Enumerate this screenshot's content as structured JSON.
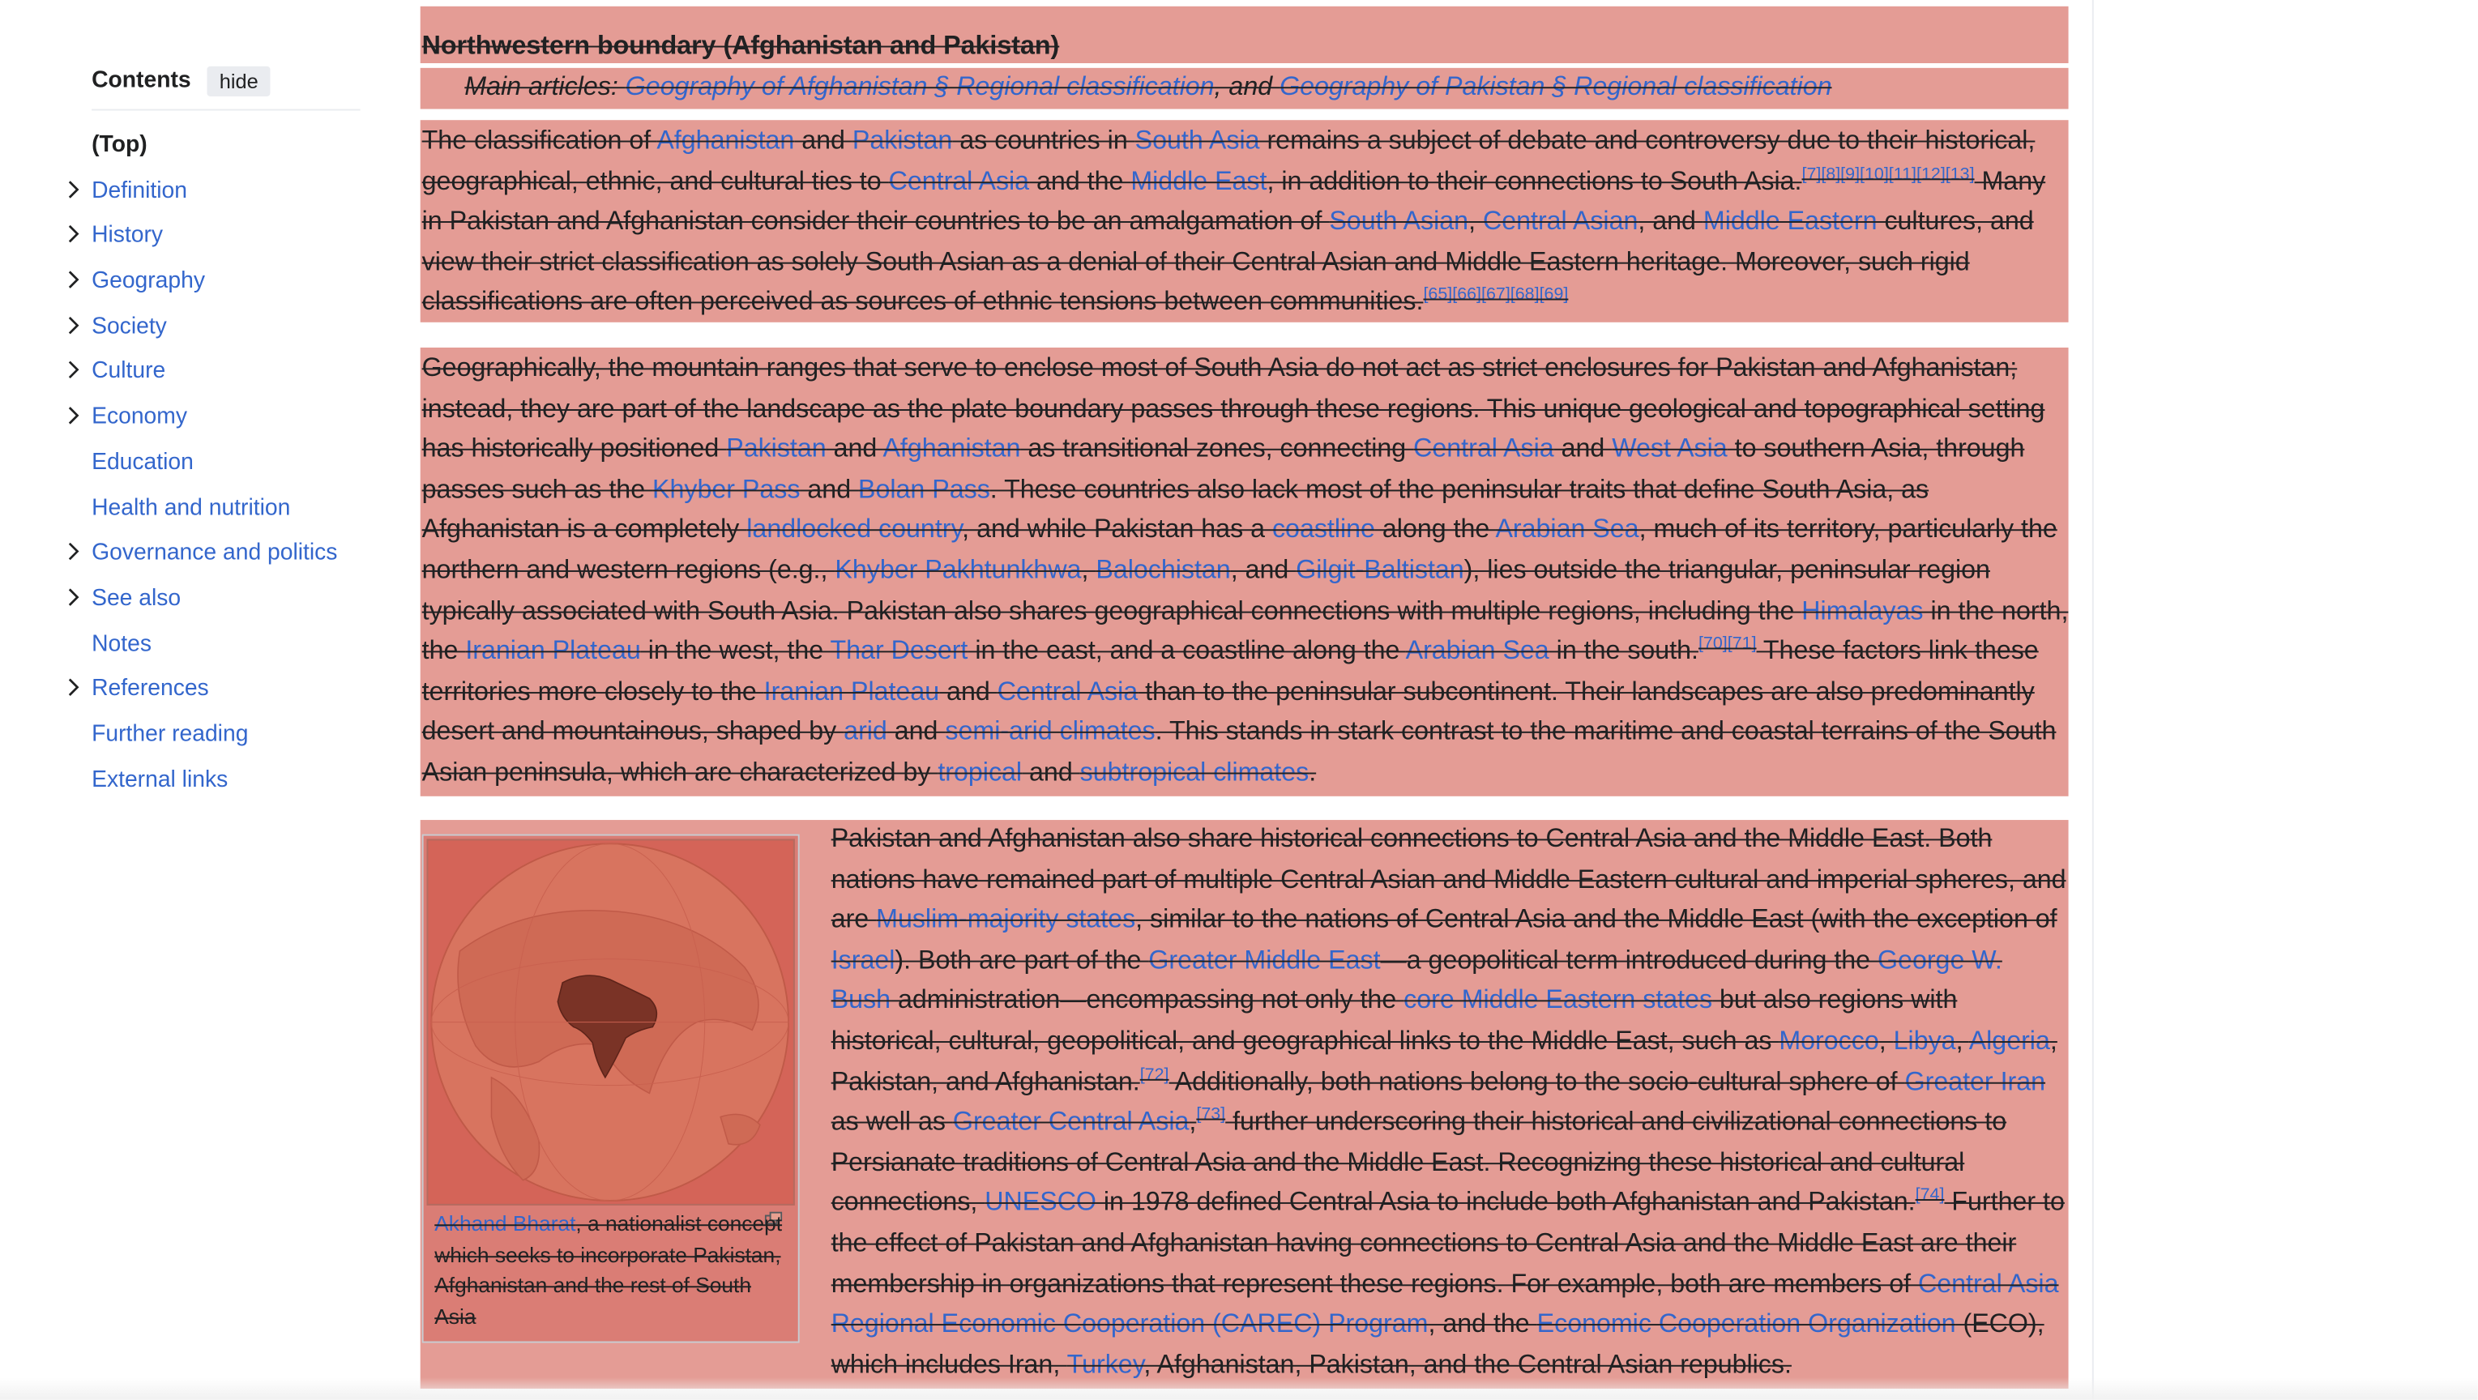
{
  "toc": {
    "title": "Contents",
    "hide_label": "hide",
    "items": [
      {
        "label": "(Top)"
      },
      {
        "label": "Definition",
        "expandable": true
      },
      {
        "label": "History",
        "expandable": true
      },
      {
        "label": "Geography",
        "expandable": true
      },
      {
        "label": "Society",
        "expandable": true
      },
      {
        "label": "Culture",
        "expandable": true
      },
      {
        "label": "Economy",
        "expandable": true
      },
      {
        "label": "Education"
      },
      {
        "label": "Health and nutrition"
      },
      {
        "label": "Governance and politics",
        "expandable": true
      },
      {
        "label": "See also",
        "expandable": true
      },
      {
        "label": "Notes"
      },
      {
        "label": "References",
        "expandable": true
      },
      {
        "label": "Further reading"
      },
      {
        "label": "External links"
      }
    ]
  },
  "section": {
    "heading": "Northwestern boundary (Afghanistan and Pakistan)",
    "hatnote": {
      "prefix": "Main articles: ",
      "link1": "Geography of Afghanistan § Regional classification",
      "sep": ", and ",
      "link2": "Geography of Pakistan § Regional classification"
    }
  },
  "p1": [
    {
      "t": "The classification of "
    },
    {
      "l": "Afghanistan"
    },
    {
      "t": " and "
    },
    {
      "l": "Pakistan"
    },
    {
      "t": " as countries in "
    },
    {
      "l": "South Asia"
    },
    {
      "t": " remains a subject of debate and controversy due to their historical, geographical, ethnic, and cultural ties to "
    },
    {
      "l": "Central Asia"
    },
    {
      "t": " and the "
    },
    {
      "l": "Middle East"
    },
    {
      "t": ", in addition to their connections to South Asia."
    },
    {
      "s": "[7][8][9][10][11][12][13]"
    },
    {
      "t": " Many in Pakistan and Afghanistan consider their countries to be an amalgamation of "
    },
    {
      "l": "South Asian"
    },
    {
      "t": ", "
    },
    {
      "l": "Central Asian"
    },
    {
      "t": ", and "
    },
    {
      "l": "Middle Eastern"
    },
    {
      "t": " cultures, and view their strict classification as solely South Asian as a denial of their Central Asian and Middle Eastern heritage. Moreover, such rigid classifications are often perceived as sources of ethnic tensions between communities."
    },
    {
      "s": "[65][66][67][68][69]"
    }
  ],
  "p2": [
    {
      "t": "Geographically, the mountain ranges that serve to enclose most of South Asia do not act as strict enclosures for Pakistan and Afghanistan; instead, they are part of the landscape as the plate boundary passes through these regions. This unique geological and topographical setting has historically positioned "
    },
    {
      "l": "Pakistan"
    },
    {
      "t": " and "
    },
    {
      "l": "Afghanistan"
    },
    {
      "t": " as transitional zones, connecting "
    },
    {
      "l": "Central Asia"
    },
    {
      "t": " and "
    },
    {
      "l": "West Asia"
    },
    {
      "t": " to southern Asia, through passes such as the "
    },
    {
      "l": "Khyber Pass"
    },
    {
      "t": " and "
    },
    {
      "l": "Bolan Pass"
    },
    {
      "t": ". These countries also lack most of the peninsular traits that define South Asia, as Afghanistan is a completely "
    },
    {
      "l": "landlocked country"
    },
    {
      "t": ", and while Pakistan has a "
    },
    {
      "l": "coastline"
    },
    {
      "t": " along the "
    },
    {
      "l": "Arabian Sea"
    },
    {
      "t": ", much of its territory, particularly the northern and western regions (e.g., "
    },
    {
      "l": "Khyber Pakhtunkhwa"
    },
    {
      "t": ", "
    },
    {
      "l": "Balochistan"
    },
    {
      "t": ", and "
    },
    {
      "l": "Gilgit-Baltistan"
    },
    {
      "t": "), lies outside the triangular, peninsular region typically associated with South Asia. Pakistan also shares geographical connections with multiple regions, including the "
    },
    {
      "l": "Himalayas"
    },
    {
      "t": " in the north, the "
    },
    {
      "l": "Iranian Plateau"
    },
    {
      "t": " in the west, the "
    },
    {
      "l": "Thar Desert"
    },
    {
      "t": " in the east, and a coastline along the "
    },
    {
      "l": "Arabian Sea"
    },
    {
      "t": " in the south."
    },
    {
      "s": "[70][71]"
    },
    {
      "t": " These factors link these territories more closely to the "
    },
    {
      "l": "Iranian Plateau"
    },
    {
      "t": " and "
    },
    {
      "l": "Central Asia"
    },
    {
      "t": " than to the peninsular subcontinent. Their landscapes are also predominantly desert and mountainous, shaped by "
    },
    {
      "l": "arid"
    },
    {
      "t": " and "
    },
    {
      "l": "semi-arid climates"
    },
    {
      "t": ". This stands in stark contrast to the maritime and coastal terrains of the South Asian peninsula, which are characterized by "
    },
    {
      "l": "tropical"
    },
    {
      "t": " and "
    },
    {
      "l": "subtropical climates"
    },
    {
      "t": "."
    }
  ],
  "p3": [
    {
      "t": "Pakistan and Afghanistan also share historical connections to Central Asia and the Middle East. Both nations have remained part of multiple Central Asian and Middle Eastern cultural and imperial spheres, and are "
    },
    {
      "l": "Muslim-majority states"
    },
    {
      "t": ", similar to the nations of Central Asia and the Middle East (with the exception of "
    },
    {
      "l": "Israel"
    },
    {
      "t": "). Both are part of the "
    },
    {
      "l": "Greater Middle East"
    },
    {
      "t": "—a geopolitical term introduced during the "
    },
    {
      "l": "George W. Bush"
    },
    {
      "t": " administration—encompassing not only the "
    },
    {
      "l": "core Middle Eastern states"
    },
    {
      "t": " but also regions with historical, cultural, geopolitical, and geographical links to the Middle East, such as "
    },
    {
      "l": "Morocco"
    },
    {
      "t": ", "
    },
    {
      "l": "Libya"
    },
    {
      "t": ", "
    },
    {
      "l": "Algeria"
    },
    {
      "t": ", Pakistan, and Afghanistan."
    },
    {
      "s": "[72]"
    },
    {
      "t": " Additionally, both nations belong to the socio-cultural sphere of "
    },
    {
      "l": "Greater Iran"
    },
    {
      "t": " as well as "
    },
    {
      "l": "Greater Central Asia"
    },
    {
      "t": ","
    },
    {
      "s": "[73]"
    },
    {
      "t": " further underscoring their historical and civilizational connections to Persianate traditions of Central Asia and the Middle East. Recognizing these historical and cultural connections, "
    },
    {
      "l": "UNESCO"
    },
    {
      "t": " in 1978 defined Central Asia to include both Afghanistan and Pakistan."
    },
    {
      "s": "[74]"
    },
    {
      "t": " Further to the effect of Pakistan and Afghanistan having connections to Central Asia and the Middle East are their membership in organizations that represent these regions. For example, both are members of "
    },
    {
      "l": "Central Asia Regional Economic Cooperation (CAREC) Program"
    },
    {
      "t": ", and the "
    },
    {
      "l": "Economic Cooperation Organization"
    },
    {
      "t": " (ECO), which includes Iran, "
    },
    {
      "l": "Turkey"
    },
    {
      "t": ", Afghanistan, Pakistan, and the Central Asian republics."
    }
  ],
  "figure": {
    "caption_link": "Akhand Bharat",
    "caption_text": ", a nationalist concept which seeks to incorporate Pakistan, Afghanistan and the rest of South Asia"
  },
  "colors": {
    "link": "#3366cc",
    "text": "#202122",
    "highlight": "#d05448"
  }
}
